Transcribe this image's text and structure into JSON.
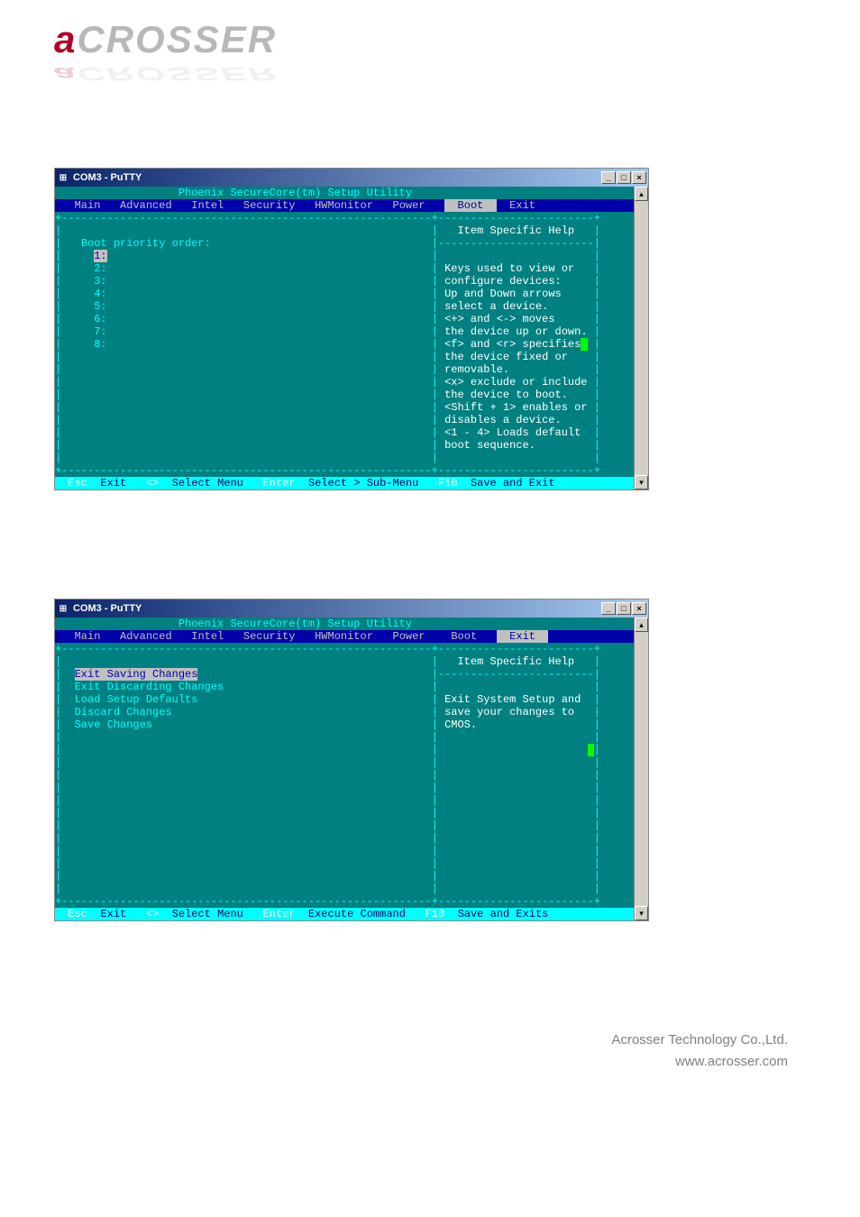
{
  "logo": {
    "letter": "a",
    "rest": "CROSSER"
  },
  "footer": {
    "company": "Acrosser Technology Co.,Ltd.",
    "url": "www.acrosser.com"
  },
  "window_title": "COM3 - PuTTY",
  "bios_title": "Phoenix SecureCore(tm) Setup Utility",
  "tabs": [
    "Main",
    "Advanced",
    "Intel",
    "Security",
    "HWMonitor",
    "Power",
    "Boot",
    "Exit"
  ],
  "help_header": "Item Specific Help",
  "boot": {
    "heading": "Boot priority order:",
    "items": [
      "1:",
      "2:",
      "3:",
      "4:",
      "5:",
      "6:",
      "7:",
      "8:"
    ],
    "help": [
      "Keys used to view or",
      "configure devices:",
      "Up and Down arrows",
      "select a device.",
      "<+> and <-> moves",
      "the device up or down.",
      "<f> and <r> specifies",
      "the device fixed or",
      "removable.",
      "<x> exclude or include",
      "the device to boot.",
      "<Shift + 1> enables or",
      "disables a device.",
      "<1 - 4> Loads default",
      "boot sequence."
    ]
  },
  "exit": {
    "items": [
      "Exit Saving Changes",
      "Exit Discarding Changes",
      "Load Setup Defaults",
      "Discard Changes",
      "Save Changes"
    ],
    "help": [
      "Exit System Setup and",
      "save your changes to",
      "CMOS."
    ]
  },
  "footbar1": {
    "k1": "Esc",
    "v1": "Exit",
    "k2": "<>",
    "v2": "Select Menu",
    "k3": "Enter",
    "v3": "Select > Sub-Menu",
    "k4": "F10",
    "v4": "Save and Exit"
  },
  "footbar2": {
    "k1": "Esc",
    "v1": "Exit",
    "k2": "<>",
    "v2": "Select Menu",
    "k3": "Enter",
    "v3": "Execute Command",
    "k4": "F10",
    "v4": "Save and Exits"
  }
}
